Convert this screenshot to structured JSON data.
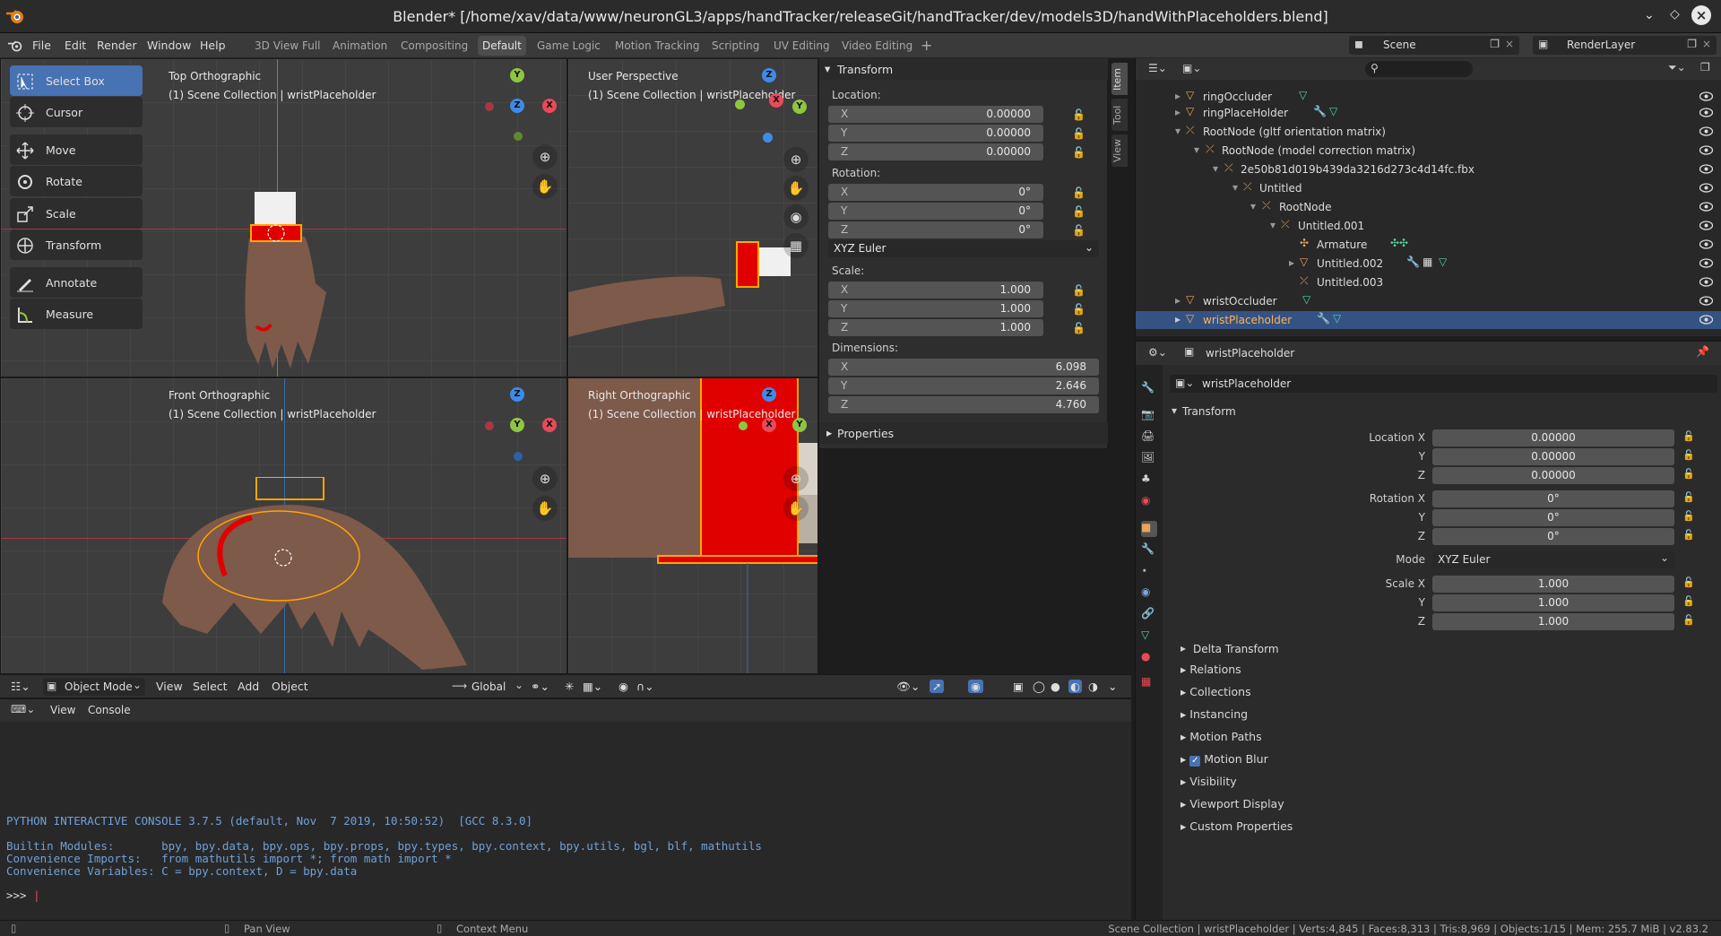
{
  "window": {
    "title": "Blender* [/home/xav/data/www/neuronGL3/apps/handTracker/releaseGit/handTracker/dev/models3D/handWithPlaceholders.blend]"
  },
  "menu": [
    "File",
    "Edit",
    "Render",
    "Window",
    "Help"
  ],
  "workspaces": [
    "3D View Full",
    "Animation",
    "Compositing",
    "Default",
    "Game Logic",
    "Motion Tracking",
    "Scripting",
    "UV Editing",
    "Video Editing"
  ],
  "active_workspace": "Default",
  "scene": "Scene",
  "render_layer": "RenderLayer",
  "tools": [
    "Select Box",
    "Cursor",
    "Move",
    "Rotate",
    "Scale",
    "Transform",
    "Annotate",
    "Measure"
  ],
  "viewports": [
    {
      "name": "Top Orthographic",
      "collection": "(1) Scene Collection | wristPlaceholder"
    },
    {
      "name": "User Perspective",
      "collection": "(1) Scene Collection | wristPlaceholder"
    },
    {
      "name": "Front Orthographic",
      "collection": "(1) Scene Collection | wristPlaceholder"
    },
    {
      "name": "Right Orthographic",
      "collection": "(1) Scene Collection | wristPlaceholder"
    }
  ],
  "npanel": {
    "transform_title": "Transform",
    "location_label": "Location:",
    "location": [
      "0.00000",
      "0.00000",
      "0.00000"
    ],
    "rotation_label": "Rotation:",
    "rotation": [
      "0°",
      "0°",
      "0°"
    ],
    "rotation_mode": "XYZ Euler",
    "scale_label": "Scale:",
    "scale": [
      "1.000",
      "1.000",
      "1.000"
    ],
    "dimensions_label": "Dimensions:",
    "dimensions": [
      "6.098",
      "2.646",
      "4.760"
    ],
    "properties_title": "Properties",
    "axes": [
      "X",
      "Y",
      "Z"
    ],
    "tabs": [
      "Item",
      "Tool",
      "View"
    ]
  },
  "viewport_header": {
    "mode": "Object Mode",
    "menus": [
      "View",
      "Select",
      "Add",
      "Object"
    ],
    "orientation": "Global"
  },
  "console_header": [
    "View",
    "Console"
  ],
  "console_lines": [
    "PYTHON INTERACTIVE CONSOLE 3.7.5 (default, Nov  7 2019, 10:50:52)  [GCC 8.3.0]",
    "Builtin Modules:       bpy, bpy.data, bpy.ops, bpy.props, bpy.types, bpy.context, bpy.utils, bgl, blf, mathutils",
    "Convenience Imports:   from mathutils import *; from math import *",
    "Convenience Variables: C = bpy.context, D = bpy.data"
  ],
  "console_prompt": ">>> ",
  "outliner": [
    {
      "name": "ringOccluder"
    },
    {
      "name": "ringPlaceHolder"
    },
    {
      "name": "RootNode (gltf orientation matrix)"
    },
    {
      "name": "RootNode (model correction matrix)"
    },
    {
      "name": "2e50b81d019b439da3216d273c4d14fc.fbx"
    },
    {
      "name": "Untitled"
    },
    {
      "name": "RootNode"
    },
    {
      "name": "Untitled.001"
    },
    {
      "name": "Armature"
    },
    {
      "name": "Untitled.002"
    },
    {
      "name": "Untitled.003"
    },
    {
      "name": "wristOccluder"
    },
    {
      "name": "wristPlaceholder"
    }
  ],
  "props": {
    "object_name": "wristPlaceholder",
    "data_name": "wristPlaceholder",
    "transform_title": "Transform",
    "location_labels": [
      "Location X",
      "Y",
      "Z"
    ],
    "location": [
      "0.00000",
      "0.00000",
      "0.00000"
    ],
    "rotation_labels": [
      "Rotation X",
      "Y",
      "Z"
    ],
    "rotation": [
      "0°",
      "0°",
      "0°"
    ],
    "mode_label": "Mode",
    "mode": "XYZ Euler",
    "scale_labels": [
      "Scale X",
      "Y",
      "Z"
    ],
    "scale": [
      "1.000",
      "1.000",
      "1.000"
    ],
    "delta": "Delta Transform",
    "sections": [
      "Relations",
      "Collections",
      "Instancing",
      "Motion Paths",
      "Motion Blur",
      "Visibility",
      "Viewport Display",
      "Custom Properties"
    ]
  },
  "status": {
    "pan": "Pan View",
    "context": "Context Menu",
    "info": "Scene Collection | wristPlaceholder | Verts:4,845 | Faces:8,313 | Tris:8,969 | Objects:1/15 | Mem: 255.7 MiB | v2.83.2"
  },
  "colors": {
    "accent": "#4772b3",
    "selection": "#345383",
    "x_axis": "#e84b57",
    "y_axis": "#8fc640",
    "z_axis": "#3f8be8",
    "placeholder": "#e00000"
  }
}
